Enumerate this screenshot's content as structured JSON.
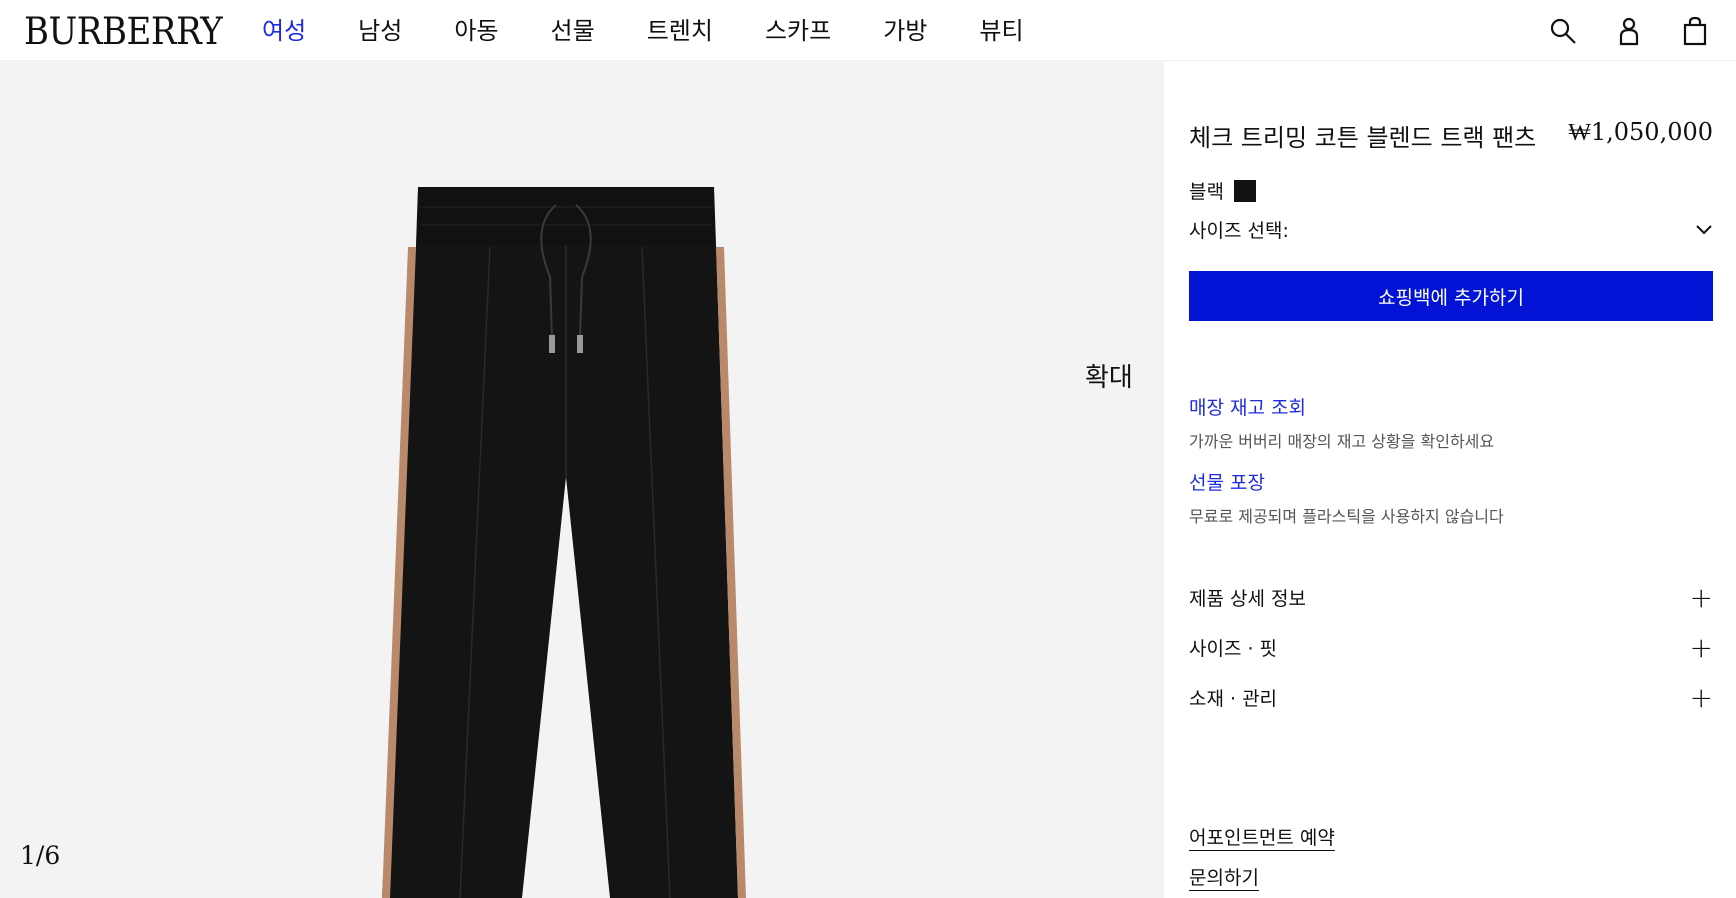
{
  "header": {
    "logo": "BURBERRY",
    "nav": [
      "여성",
      "남성",
      "아동",
      "선물",
      "트렌치",
      "스카프",
      "가방",
      "뷰티"
    ],
    "active_nav": "여성",
    "icons": [
      "search-icon",
      "account-icon",
      "shopping-bag-icon"
    ]
  },
  "gallery": {
    "zoom_label": "확대",
    "counter": "1/6"
  },
  "product": {
    "title": "체크 트리밍 코튼 블렌드 트랙 팬츠",
    "price": "₩1,050,000",
    "color_label": "블랙",
    "color_hex": "#111111",
    "size_label": "사이즈 선택:",
    "add_button": "쇼핑백에 추가하기"
  },
  "services": [
    {
      "title": "매장 재고 조회",
      "subtitle": "가까운 버버리 매장의 재고 상황을 확인하세요"
    },
    {
      "title": "선물 포장",
      "subtitle": "무료로 제공되며 플라스틱을 사용하지 않습니다"
    }
  ],
  "accordions": [
    "제품 상세 정보",
    "사이즈 · 핏",
    "소재 · 관리"
  ],
  "bottom_links": [
    "어포인트먼트 예약",
    "문의하기"
  ],
  "colors": {
    "accent": "#1f2be0",
    "button": "#0313d6"
  }
}
